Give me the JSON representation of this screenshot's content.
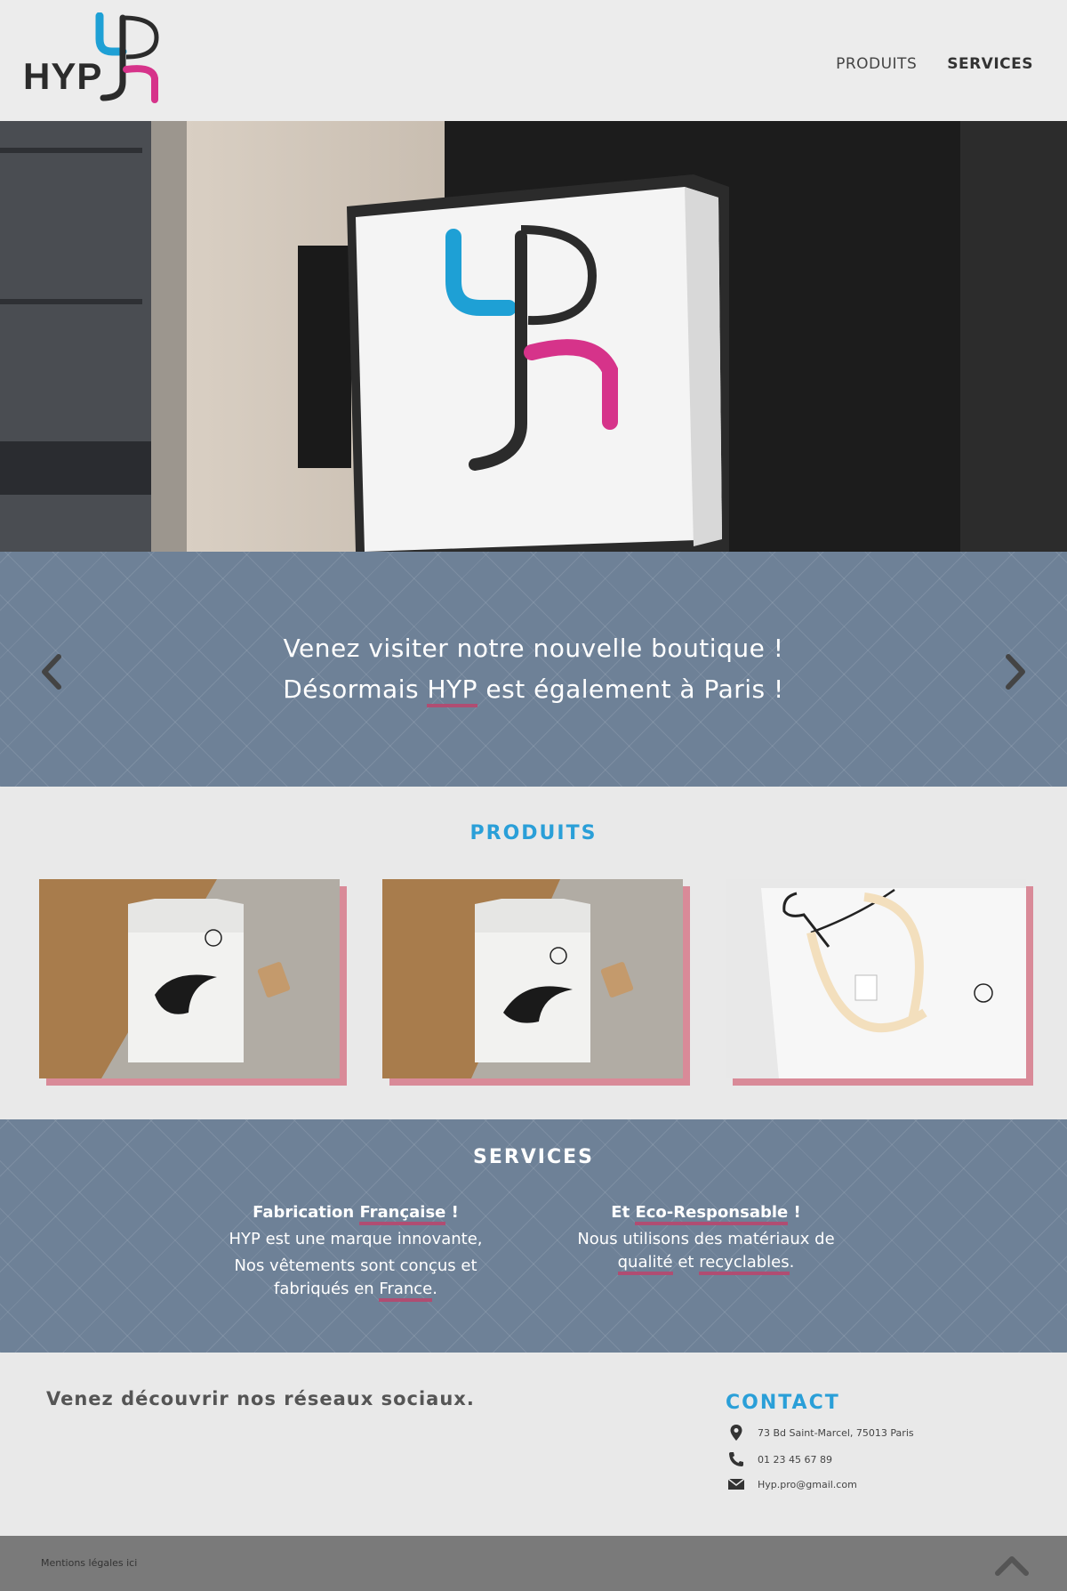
{
  "header": {
    "logo_text": "HYP",
    "nav": [
      {
        "label": "PRODUITS"
      },
      {
        "label": "SERVICES"
      }
    ]
  },
  "slider": {
    "line1": "Venez visiter notre nouvelle boutique !",
    "line2_before": "Désormais ",
    "line2_highlight": "HYP",
    "line2_after": " est également à Paris !"
  },
  "produits": {
    "title": "PRODUITS"
  },
  "services": {
    "title": "SERVICES",
    "left": {
      "heading_before": "Fabrication ",
      "heading_highlight": "Française",
      "heading_after": " !",
      "line1": "HYP est une marque innovante,",
      "line2": "Nos vêtements sont conçus et",
      "line3_before": "fabriqués en ",
      "line3_highlight": "France",
      "line3_after": "."
    },
    "right": {
      "heading_before": "Et ",
      "heading_highlight": "Eco-Responsable",
      "heading_after": " !",
      "line1": "Nous utilisons des matériaux de",
      "line2_highlight1": "qualité",
      "line2_mid": " et ",
      "line2_highlight2": "recyclables",
      "line2_after": "."
    }
  },
  "footer": {
    "social": "Venez découvrir nos réseaux sociaux.",
    "contact_title": "CONTACT",
    "address": "73 Bd Saint-Marcel, 75013 Paris",
    "phone": "01 23 45 67 89",
    "email": "Hyp.pro@gmail.com",
    "legal": "Mentions légales ici"
  },
  "colors": {
    "accent_blue": "#2a9fd8",
    "accent_pink": "#d6338a",
    "band": "#6e8197",
    "highlight": "#b04d72"
  }
}
